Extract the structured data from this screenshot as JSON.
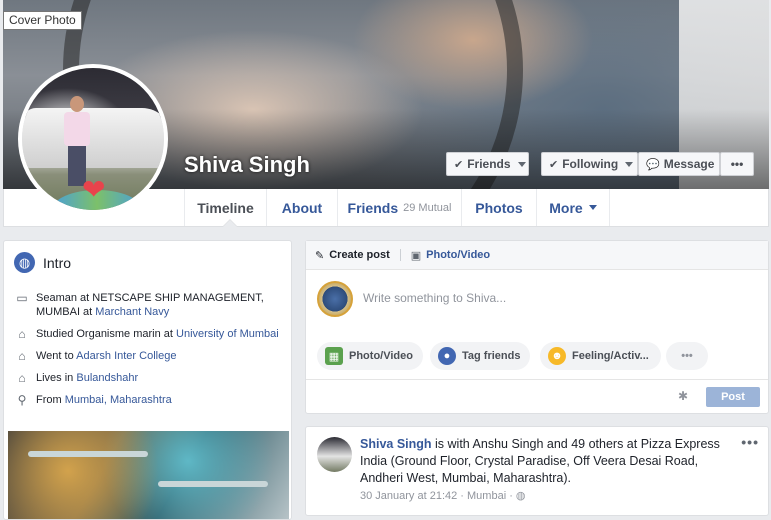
{
  "cover": {
    "tooltip": "Cover Photo",
    "name": "Shiva Singh"
  },
  "actions": {
    "friends": "Friends",
    "following": "Following",
    "message": "Message",
    "more": "•••"
  },
  "nav": {
    "timeline": "Timeline",
    "about": "About",
    "friends": "Friends",
    "friends_mutual": "29 Mutual",
    "photos": "Photos",
    "more": "More"
  },
  "intro": {
    "title": "Intro",
    "items": [
      {
        "icon": "briefcase-icon",
        "text": "Seaman at NETSCAPE SHIP MANAGEMENT, MUMBAI at ",
        "link": "Marchant Navy"
      },
      {
        "icon": "graduation-cap-icon",
        "text": "Studied Organisme marin at ",
        "link": "University of Mumbai"
      },
      {
        "icon": "school-icon",
        "text": "Went to ",
        "link": "Adarsh Inter College"
      },
      {
        "icon": "home-icon",
        "text": "Lives in ",
        "link": "Bulandshahr"
      },
      {
        "icon": "location-pin-icon",
        "text": "From ",
        "link": "Mumbai, Maharashtra"
      }
    ]
  },
  "composer": {
    "create_post": "Create post",
    "photo_video_tab": "Photo/Video",
    "placeholder": "Write something to Shiva...",
    "photo_video": "Photo/Video",
    "tag_friends": "Tag friends",
    "feeling": "Feeling/Activ...",
    "more": "•••",
    "post": "Post"
  },
  "post": {
    "author": "Shiva Singh",
    "text_1": " is with Anshu Singh and 49 others at Pizza Express India (Ground Floor, Crystal Paradise, Off Veera Desai Road, Andheri West, Mumbai, Maharashtra).",
    "meta": "30 January at 21:42 · Mumbai ·",
    "menu": "•••"
  }
}
